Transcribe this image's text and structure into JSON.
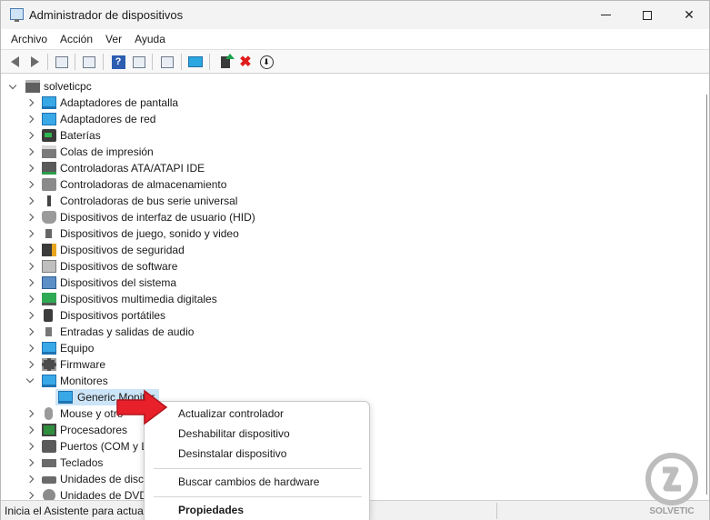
{
  "window": {
    "title": "Administrador de dispositivos",
    "controls": {
      "minimize": "",
      "maximize": "",
      "close": "✕"
    }
  },
  "menubar": {
    "items": [
      "Archivo",
      "Acción",
      "Ver",
      "Ayuda"
    ]
  },
  "toolbar": {
    "buttons": [
      "back-icon",
      "forward-icon",
      "properties-icon",
      "refresh-icon",
      "help-icon",
      "view-icon",
      "print-icon",
      "monitor-icon",
      "update-driver-icon",
      "uninstall-icon",
      "download-icon"
    ],
    "uninstall_glyph": "✖",
    "download_glyph": "⬇",
    "help_glyph": "?"
  },
  "tree": {
    "root": "solveticpc",
    "items": [
      {
        "label": "Adaptadores de pantalla",
        "icon": "display-adapter-icon",
        "expanded": false
      },
      {
        "label": "Adaptadores de red",
        "icon": "network-adapter-icon",
        "expanded": false
      },
      {
        "label": "Baterías",
        "icon": "battery-icon",
        "expanded": false
      },
      {
        "label": "Colas de impresión",
        "icon": "printer-icon",
        "expanded": false
      },
      {
        "label": "Controladoras ATA/ATAPI IDE",
        "icon": "ide-controller-icon",
        "expanded": false
      },
      {
        "label": "Controladoras de almacenamiento",
        "icon": "storage-controller-icon",
        "expanded": false
      },
      {
        "label": "Controladoras de bus serie universal",
        "icon": "usb-icon",
        "expanded": false
      },
      {
        "label": "Dispositivos de interfaz de usuario (HID)",
        "icon": "hid-icon",
        "expanded": false
      },
      {
        "label": "Dispositivos de juego, sonido y video",
        "icon": "sound-icon",
        "expanded": false
      },
      {
        "label": "Dispositivos de seguridad",
        "icon": "security-icon",
        "expanded": false
      },
      {
        "label": "Dispositivos de software",
        "icon": "software-icon",
        "expanded": false
      },
      {
        "label": "Dispositivos del sistema",
        "icon": "system-icon",
        "expanded": false
      },
      {
        "label": "Dispositivos multimedia digitales",
        "icon": "multimedia-icon",
        "expanded": false
      },
      {
        "label": "Dispositivos portátiles",
        "icon": "portable-icon",
        "expanded": false
      },
      {
        "label": "Entradas y salidas de audio",
        "icon": "audio-icon",
        "expanded": false
      },
      {
        "label": "Equipo",
        "icon": "computer-icon",
        "expanded": false
      },
      {
        "label": "Firmware",
        "icon": "firmware-icon",
        "expanded": false
      },
      {
        "label": "Monitores",
        "icon": "monitor-icon",
        "expanded": true
      },
      {
        "label": "Generic Monitor",
        "icon": "monitor-icon",
        "child": true
      },
      {
        "label": "Mouse y otro",
        "icon": "mouse-icon",
        "expanded": false
      },
      {
        "label": "Procesadores",
        "icon": "cpu-icon",
        "expanded": false
      },
      {
        "label": "Puertos (COM y L",
        "icon": "port-icon",
        "expanded": false
      },
      {
        "label": "Teclados",
        "icon": "keyboard-icon",
        "expanded": false
      },
      {
        "label": "Unidades de disco",
        "icon": "disk-icon",
        "expanded": false
      },
      {
        "label": "Unidades de DVD",
        "icon": "dvd-icon",
        "expanded": false
      }
    ]
  },
  "context_menu": {
    "items": [
      {
        "label": "Actualizar controlador",
        "bold": false
      },
      {
        "label": "Deshabilitar dispositivo",
        "bold": false
      },
      {
        "label": "Desinstalar dispositivo",
        "bold": false
      },
      {
        "label": "Buscar cambios de hardware",
        "bold": false
      },
      {
        "label": "Propiedades",
        "bold": true
      }
    ]
  },
  "statusbar": {
    "text": "Inicia el Asistente para actual"
  },
  "watermark": {
    "text": "SOLVETIC"
  },
  "colors": {
    "accent": "#39a8e6",
    "selection": "#cce4f7",
    "arrow_red": "#e8202a"
  }
}
